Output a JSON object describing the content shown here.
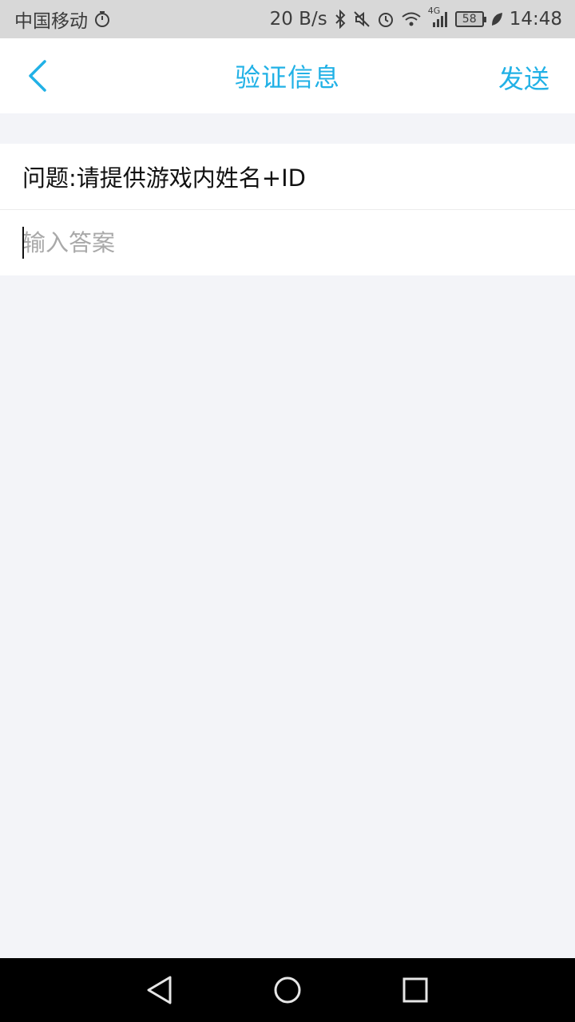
{
  "status_bar": {
    "carrier": "中国移动",
    "net_speed": "20 B/s",
    "network": "4G",
    "battery": "58",
    "time": "14:48",
    "icons": [
      "stopwatch-icon",
      "bluetooth-icon",
      "mute-icon",
      "alarm-icon",
      "wifi-icon",
      "signal-icon",
      "battery-icon",
      "leaf-icon"
    ]
  },
  "header": {
    "title": "验证信息",
    "send_label": "发送",
    "back_icon": "chevron-left-icon"
  },
  "form": {
    "question": "问题:请提供游戏内姓名+ID",
    "answer_value": "",
    "answer_placeholder": "输入答案"
  },
  "nav_bar": {
    "icons": [
      "back-triangle-icon",
      "home-circle-icon",
      "recents-square-icon"
    ]
  },
  "colors": {
    "accent": "#21b1e6",
    "background": "#f3f4f8",
    "status_bar": "#d8d8d8",
    "nav_bar": "#000000"
  }
}
